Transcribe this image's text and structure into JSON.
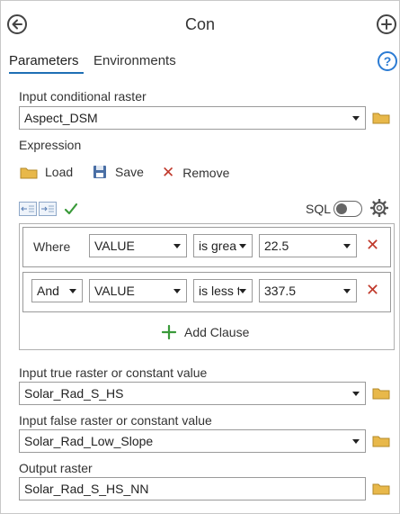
{
  "header": {
    "title": "Con",
    "back_icon": "back-arrow-icon",
    "add_icon": "plus-circle-icon"
  },
  "tabs": [
    {
      "label": "Parameters",
      "active": true
    },
    {
      "label": "Environments",
      "active": false
    }
  ],
  "help_icon": "help-icon",
  "input_conditional_raster": {
    "label": "Input conditional raster",
    "value": "Aspect_DSM"
  },
  "expression": {
    "label": "Expression",
    "load_label": "Load",
    "save_label": "Save",
    "remove_label": "Remove",
    "sql_label": "SQL",
    "sql_enabled": false,
    "clauses": [
      {
        "connector": "Where",
        "field": "VALUE",
        "operator": "is grea",
        "value": "22.5"
      },
      {
        "connector": "And",
        "field": "VALUE",
        "operator": "is less t",
        "value": "337.5"
      }
    ],
    "add_clause_label": "Add Clause"
  },
  "input_true": {
    "label": "Input true raster or constant value",
    "value": "Solar_Rad_S_HS"
  },
  "input_false": {
    "label": "Input false raster or constant value",
    "value": "Solar_Rad_Low_Slope"
  },
  "output_raster": {
    "label": "Output raster",
    "value": "Solar_Rad_S_HS_NN"
  },
  "colors": {
    "accent": "#1f6fb5",
    "remove_x": "#c0392b",
    "folder": "#e8b84a",
    "check": "#3a9a3a",
    "add_plus": "#3a9a3a"
  }
}
